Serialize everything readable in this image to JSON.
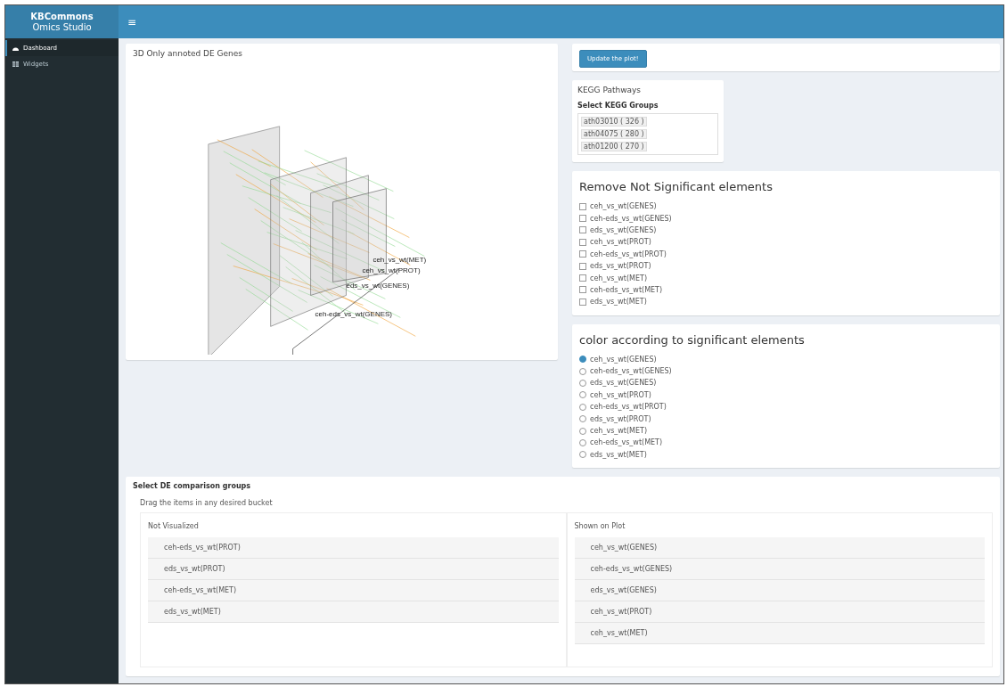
{
  "brand": {
    "title": "KBCommons",
    "subtitle": "Omics Studio"
  },
  "header": {
    "menu_icon": "≡"
  },
  "sidebar": {
    "items": [
      {
        "label": "Dashboard",
        "kind": "dashboard",
        "selected": true
      },
      {
        "label": "Widgets",
        "kind": "widgets",
        "selected": false
      }
    ]
  },
  "plot": {
    "title": "3D Only annoted DE Genes",
    "plane_labels": [
      "ceh_vs_wt(MET)",
      "ceh_vs_wt(PROT)",
      "eds_vs_wt(GENES)",
      "ceh-eds_vs_wt(GENES)"
    ]
  },
  "update_button": "Update the plot!",
  "kegg": {
    "title": "KEGG Pathways",
    "label": "Select KEGG Groups",
    "chips": [
      "ath03010 ( 326 )",
      "ath04075 ( 280 )",
      "ath01200 ( 270 )"
    ]
  },
  "remove": {
    "title": "Remove Not Significant elements",
    "options": [
      {
        "label": "ceh_vs_wt(GENES)",
        "checked": false
      },
      {
        "label": "ceh-eds_vs_wt(GENES)",
        "checked": false
      },
      {
        "label": "eds_vs_wt(GENES)",
        "checked": false
      },
      {
        "label": "ceh_vs_wt(PROT)",
        "checked": false
      },
      {
        "label": "ceh-eds_vs_wt(PROT)",
        "checked": false
      },
      {
        "label": "eds_vs_wt(PROT)",
        "checked": false
      },
      {
        "label": "ceh_vs_wt(MET)",
        "checked": false
      },
      {
        "label": "ceh-eds_vs_wt(MET)",
        "checked": false
      },
      {
        "label": "eds_vs_wt(MET)",
        "checked": false
      }
    ]
  },
  "color": {
    "title": "color according to significant elements",
    "options": [
      {
        "label": "ceh_vs_wt(GENES)",
        "selected": true
      },
      {
        "label": "ceh-eds_vs_wt(GENES)",
        "selected": false
      },
      {
        "label": "eds_vs_wt(GENES)",
        "selected": false
      },
      {
        "label": "ceh_vs_wt(PROT)",
        "selected": false
      },
      {
        "label": "ceh-eds_vs_wt(PROT)",
        "selected": false
      },
      {
        "label": "eds_vs_wt(PROT)",
        "selected": false
      },
      {
        "label": "ceh_vs_wt(MET)",
        "selected": false
      },
      {
        "label": "ceh-eds_vs_wt(MET)",
        "selected": false
      },
      {
        "label": "eds_vs_wt(MET)",
        "selected": false
      }
    ]
  },
  "groups": {
    "title": "Select DE comparison groups",
    "hint": "Drag the items in any desired bucket",
    "buckets": [
      {
        "title": "Not Visualized",
        "items": [
          "ceh-eds_vs_wt(PROT)",
          "eds_vs_wt(PROT)",
          "ceh-eds_vs_wt(MET)",
          "eds_vs_wt(MET)"
        ]
      },
      {
        "title": "Shown on Plot",
        "items": [
          "ceh_vs_wt(GENES)",
          "ceh-eds_vs_wt(GENES)",
          "eds_vs_wt(GENES)",
          "ceh_vs_wt(PROT)",
          "ceh_vs_wt(MET)"
        ]
      }
    ]
  }
}
